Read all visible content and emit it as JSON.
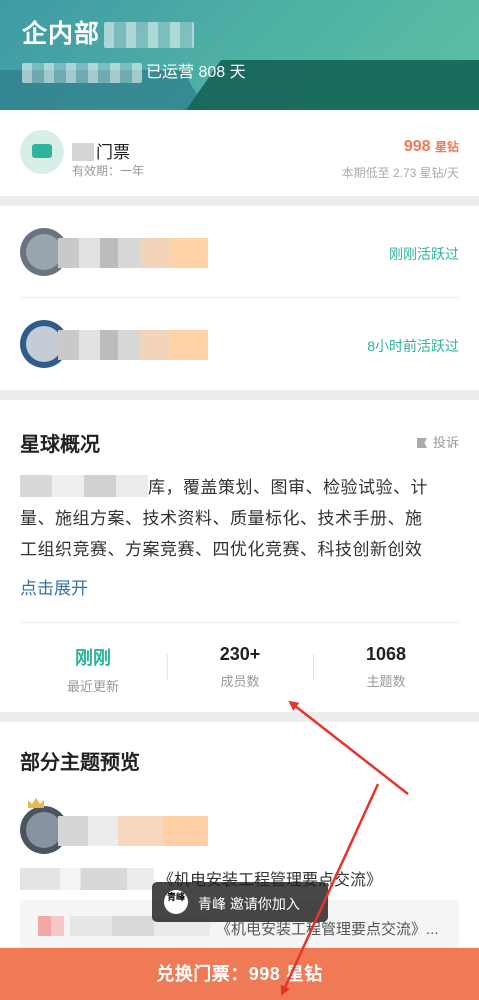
{
  "header": {
    "title_prefix": "企内部",
    "days_text": "已运营 808 天"
  },
  "ticket": {
    "name": "门票",
    "validity": "有效期：一年",
    "price": "998",
    "price_unit": "星钻",
    "low_rate": "本期低至 2.73 星钻/天"
  },
  "members": [
    {
      "status": "刚刚活跃过"
    },
    {
      "status": "8小时前活跃过"
    }
  ],
  "overview": {
    "title": "星球概况",
    "report_label": "投诉",
    "text_line1_tail": "库，覆盖策划、图审、检验试验、计",
    "text_line2": "量、施组方案、技术资料、质量标化、技术手册、施",
    "text_line3": "工组织竞赛、方案竞赛、四优化竞赛、科技创新创效",
    "expand_label": "点击展开",
    "stats": [
      {
        "value": "刚刚",
        "label": "最近更新"
      },
      {
        "value": "230+",
        "label": "成员数"
      },
      {
        "value": "1068",
        "label": "主题数"
      }
    ]
  },
  "preview": {
    "title": "部分主题预览",
    "topic_line": "《机电安装工程管理要点交流》",
    "card_text": "《机电安装工程管理要点交流》..."
  },
  "toast": {
    "avatar_text": "青峰",
    "text": "青峰 邀请你加入"
  },
  "cta": {
    "label": "兑换门票：998 星钻"
  },
  "colors": {
    "accent_green": "#2fb39b",
    "accent_orange": "#f07a55",
    "link_blue": "#3a72a8",
    "annotation_red": "#e8332a"
  }
}
